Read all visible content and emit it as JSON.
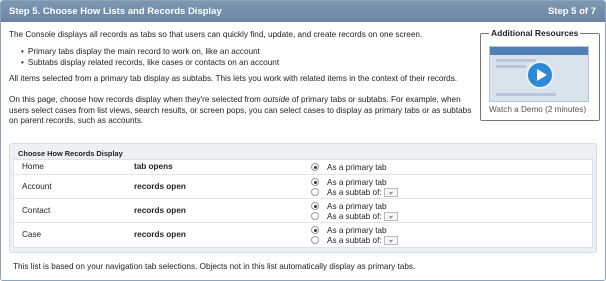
{
  "header": {
    "title": "Step 5. Choose How Lists and Records Display",
    "step": "Step 5 of 7"
  },
  "intro": "The Console displays all records as tabs so that users can quickly find, update, and create records on one screen.",
  "bullets": [
    "Primary tabs display the main record to work on, like an account",
    "Subtabs display related records, like cases or contacts on an account"
  ],
  "para2": "All items selected from a primary tab display as subtabs. This lets you work with related items in the context of their records.",
  "para3": {
    "line1_start": "On this page, choose how records display when they're selected from ",
    "line1_em": "outside",
    "line1_end": " of primary tabs or subtabs. For example, when",
    "line2": "users select cases from list views, search results, or screen pops, you can select cases to display as primary tabs or as subtabs",
    "line3": "on parent records, such as accounts."
  },
  "resources": {
    "title": "Additional Resources",
    "demo_link": "Watch a Demo (2 minutes)"
  },
  "records_table": {
    "title": "Choose How Records Display",
    "rows": [
      {
        "object": "Home",
        "behavior": "tab opens",
        "options": [
          "As a primary tab"
        ]
      },
      {
        "object": "Account",
        "behavior": "records open",
        "options": [
          "As a primary tab",
          "As a subtab of:"
        ]
      },
      {
        "object": "Contact",
        "behavior": "records open",
        "options": [
          "As a primary tab",
          "As a subtab of:"
        ]
      },
      {
        "object": "Case",
        "behavior": "records open",
        "options": [
          "As a primary tab",
          "As a subtab of:"
        ]
      }
    ]
  },
  "footer_note": "This list is based on your navigation tab selections. Objects not in this list automatically display as primary tabs."
}
